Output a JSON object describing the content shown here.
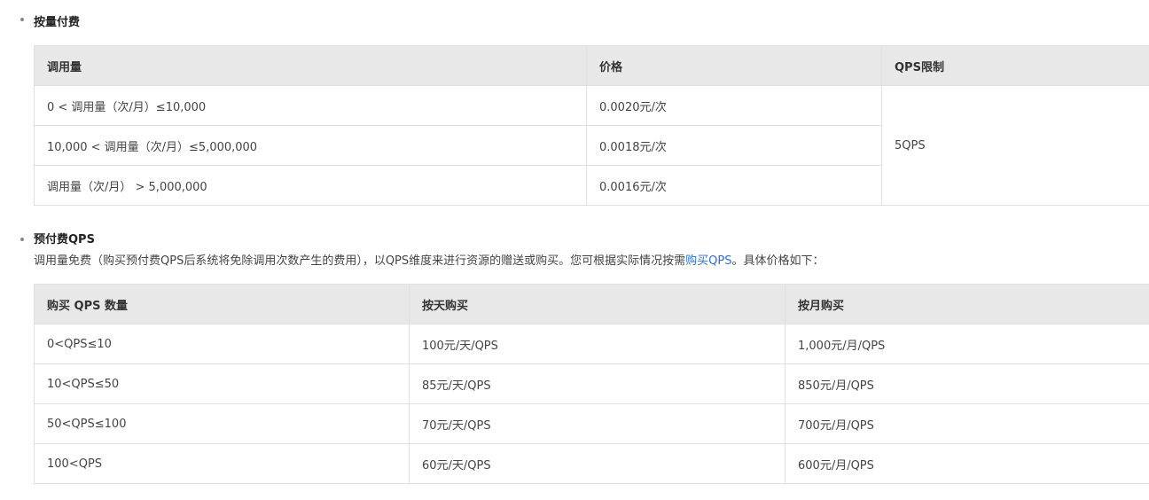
{
  "section1": {
    "title": "按量付费",
    "columns": [
      "调用量",
      "价格",
      "QPS限制"
    ],
    "rows": [
      {
        "volume": "0 < 调用量（次/月）≤10,000",
        "price": "0.0020元/次"
      },
      {
        "volume": "10,000 < 调用量（次/月）≤5,000,000",
        "price": "0.0018元/次"
      },
      {
        "volume": "调用量（次/月） > 5,000,000",
        "price": "0.0016元/次"
      }
    ],
    "qps_limit": "5QPS"
  },
  "section2": {
    "title": "预付费QPS",
    "desc_before": "调用量免费（购买预付费QPS后系统将免除调用次数产生的费用），以QPS维度来进行资源的赠送或购买。您可根据实际情况按需",
    "desc_link": "购买QPS",
    "desc_after": "。具体价格如下：",
    "columns": [
      "购买 QPS 数量",
      "按天购买",
      "按月购买"
    ],
    "rows": [
      [
        "0<QPS≤10",
        "100元/天/QPS",
        "1,000元/月/QPS"
      ],
      [
        "10<QPS≤50",
        "85元/天/QPS",
        "850元/月/QPS"
      ],
      [
        "50<QPS≤100",
        "70元/天/QPS",
        "700元/月/QPS"
      ],
      [
        "100<QPS",
        "60元/天/QPS",
        "600元/月/QPS"
      ]
    ]
  },
  "colors": {
    "link": "#2f6fd6",
    "header_bg": "#e8e8e8",
    "border": "#e0e0e0"
  }
}
